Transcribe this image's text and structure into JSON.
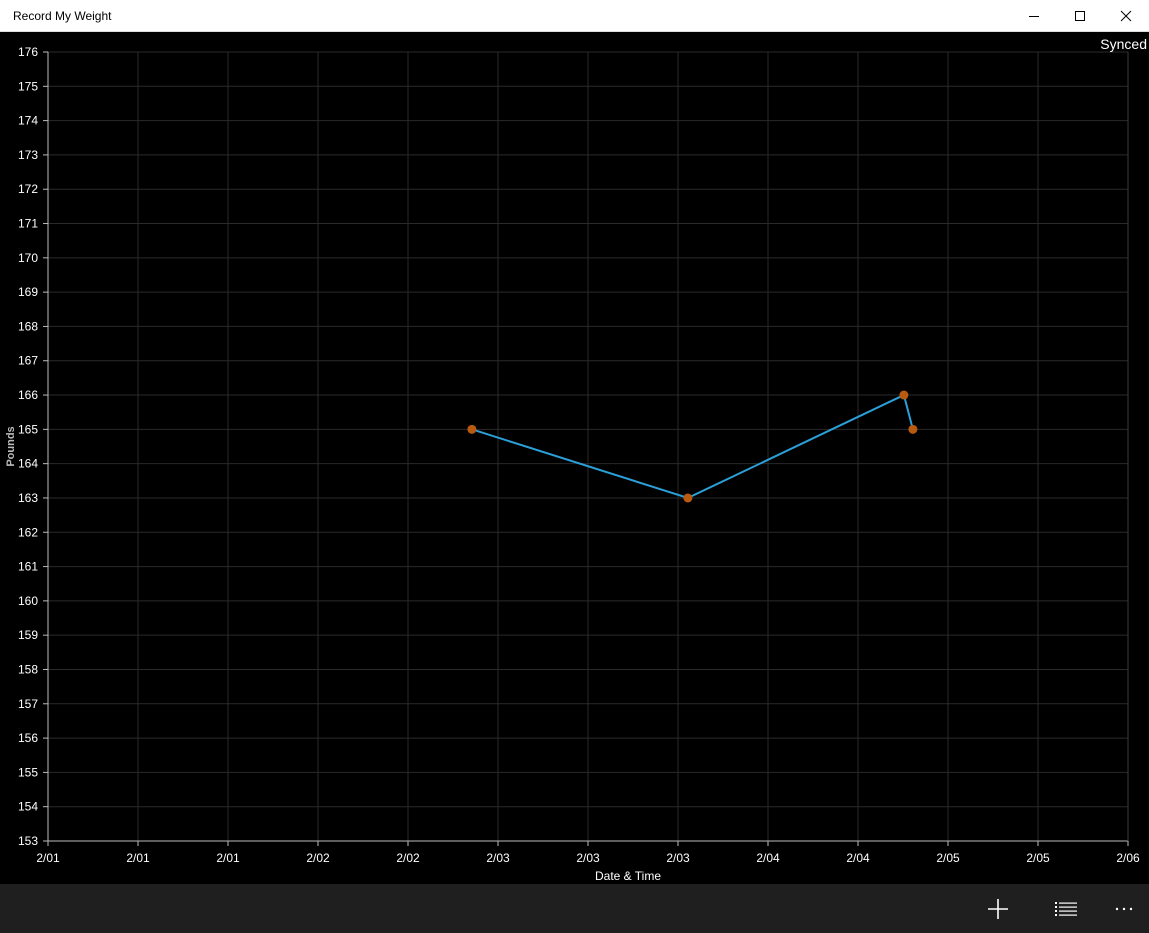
{
  "window": {
    "title": "Record My Weight"
  },
  "status": {
    "sync_text": "Synced"
  },
  "chart_data": {
    "type": "line",
    "xlabel": "Date & Time",
    "ylabel": "Pounds",
    "ylim": [
      153,
      176
    ],
    "x_tick_labels": [
      "2/01",
      "2/01",
      "2/01",
      "2/02",
      "2/02",
      "2/03",
      "2/03",
      "2/03",
      "2/04",
      "2/04",
      "2/05",
      "2/05",
      "2/06"
    ],
    "y_ticks": [
      153,
      154,
      155,
      156,
      157,
      158,
      159,
      160,
      161,
      162,
      163,
      164,
      165,
      166,
      167,
      168,
      169,
      170,
      171,
      172,
      173,
      174,
      175,
      176
    ],
    "x_tick_count": 13,
    "points": [
      {
        "x_tick_pos": 4.71,
        "y": 165
      },
      {
        "x_tick_pos": 7.11,
        "y": 163
      },
      {
        "x_tick_pos": 9.51,
        "y": 166
      },
      {
        "x_tick_pos": 9.61,
        "y": 165
      }
    ],
    "grid": true,
    "line_color": "#2ba0d8",
    "marker_color": "#b85a0f"
  },
  "appbar": {
    "add_icon": "plus-icon",
    "list_icon": "list-icon",
    "more_icon": "more-icon",
    "more_text": "···"
  }
}
